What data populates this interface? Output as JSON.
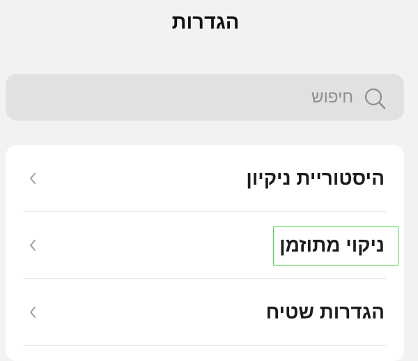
{
  "header": {
    "title": "הגדרות"
  },
  "search": {
    "placeholder": "חיפוש",
    "icon": "search-icon"
  },
  "settings": {
    "items": [
      {
        "label": "היסטוריית ניקיון",
        "icon": "chevron-left-icon"
      },
      {
        "label": "ניקוי מתוזמן",
        "icon": "chevron-left-icon"
      },
      {
        "label": "הגדרות שטיח",
        "icon": "chevron-left-icon"
      }
    ]
  },
  "colors": {
    "background": "#f2f2f2",
    "search_bg": "#e1e1e1",
    "card_bg": "#ffffff",
    "highlight": "#49d64a"
  }
}
